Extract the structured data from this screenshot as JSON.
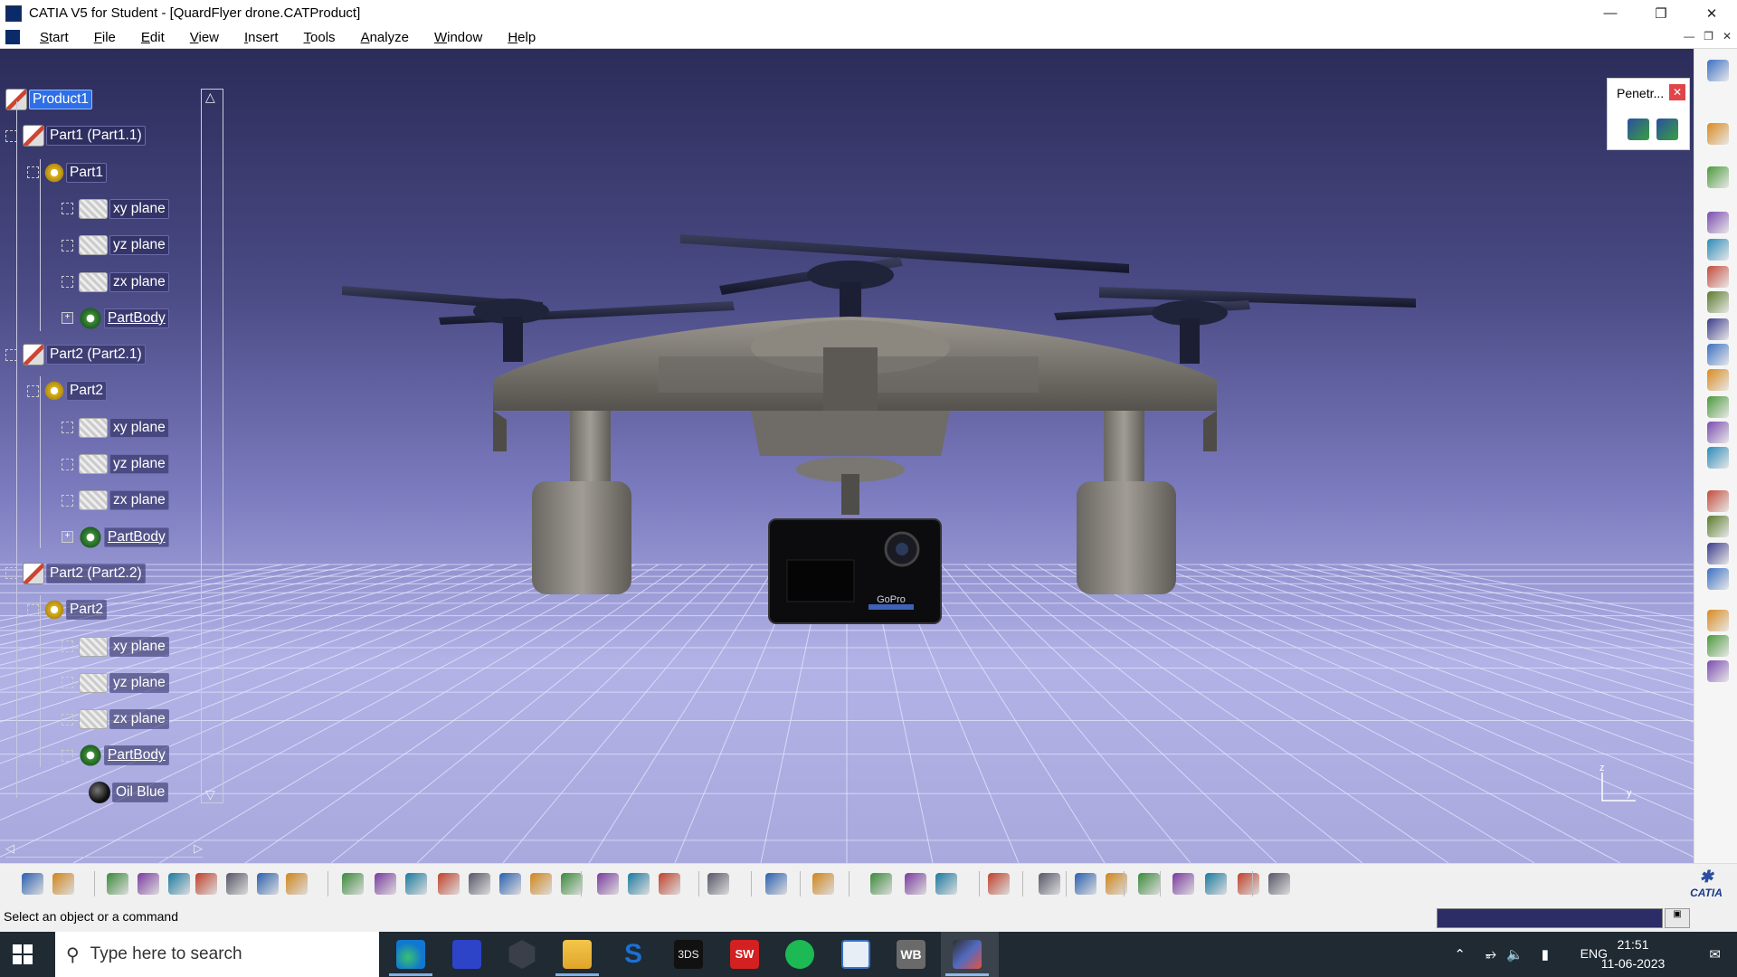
{
  "window": {
    "title": "CATIA V5 for Student - [QuardFlyer drone.CATProduct]"
  },
  "menu": [
    "Start",
    "File",
    "Edit",
    "View",
    "Insert",
    "Tools",
    "Analyze",
    "Window",
    "Help"
  ],
  "tree": {
    "nodes": [
      {
        "label": "Product1",
        "icon": "product-icon",
        "level": 0,
        "selected": true
      },
      {
        "label": "Part1 (Part1.1)",
        "icon": "product-icon",
        "level": 1
      },
      {
        "label": "Part1",
        "icon": "gear-icon",
        "level": 2
      },
      {
        "label": "xy plane",
        "icon": "plane-icon",
        "level": 3
      },
      {
        "label": "yz plane",
        "icon": "plane-icon",
        "level": 3
      },
      {
        "label": "zx plane",
        "icon": "plane-icon",
        "level": 3
      },
      {
        "label": "PartBody",
        "icon": "partbody-icon",
        "level": 3,
        "expandable": true,
        "underline": true
      },
      {
        "label": "Part2 (Part2.1)",
        "icon": "product-icon",
        "level": 1
      },
      {
        "label": "Part2",
        "icon": "gear-icon",
        "level": 2
      },
      {
        "label": "xy plane",
        "icon": "plane-icon",
        "level": 3
      },
      {
        "label": "yz plane",
        "icon": "plane-icon",
        "level": 3
      },
      {
        "label": "zx plane",
        "icon": "plane-icon",
        "level": 3
      },
      {
        "label": "PartBody",
        "icon": "partbody-icon",
        "level": 3,
        "expandable": true,
        "underline": true
      },
      {
        "label": "Part2 (Part2.2)",
        "icon": "product-icon",
        "level": 1
      },
      {
        "label": "Part2",
        "icon": "gear-icon",
        "level": 2
      },
      {
        "label": "xy plane",
        "icon": "plane-icon",
        "level": 3
      },
      {
        "label": "yz plane",
        "icon": "plane-icon",
        "level": 3
      },
      {
        "label": "zx plane",
        "icon": "plane-icon",
        "level": 3
      },
      {
        "label": "PartBody",
        "icon": "partbody-icon",
        "level": 3,
        "underline": true
      },
      {
        "label": "Oil Blue",
        "icon": "material-icon",
        "level": 4
      }
    ]
  },
  "penetration_panel": {
    "title": "Penetr..."
  },
  "compass": {
    "z_label": "z",
    "y_label": "y"
  },
  "camera_brand": "GoPro",
  "bottom_toolbar": {
    "logo": "CATIA"
  },
  "status": {
    "message": "Select an object or a command"
  },
  "taskbar": {
    "search_placeholder": "Type here to search",
    "language": "ENG",
    "time": "21:51",
    "date": "11-06-2023"
  },
  "colors": {
    "viewport_top": "#2b2c59",
    "viewport_bottom": "#b2b2e6",
    "selection": "#2f6fe6",
    "taskbar": "#1f2a33"
  }
}
